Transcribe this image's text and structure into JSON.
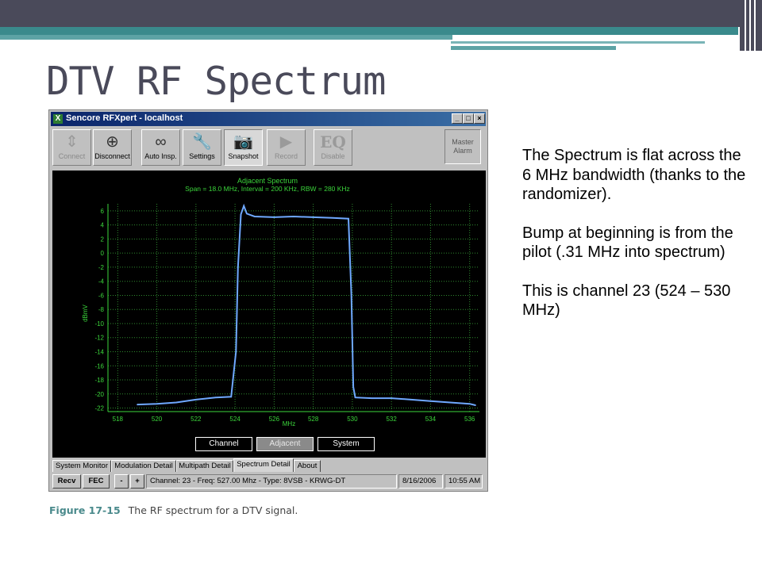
{
  "slide": {
    "title": "DTV RF Spectrum",
    "notes": [
      "The Spectrum is flat across the 6 MHz bandwidth (thanks to the randomizer).",
      "Bump at beginning is from the pilot (.31 MHz into spectrum)",
      "This is channel 23 (524 – 530 MHz)"
    ],
    "caption_label": "Figure 17-15",
    "caption_text": "The RF spectrum for a DTV signal."
  },
  "window": {
    "title": "Sencore RFXpert - localhost",
    "controls": [
      "_",
      "□",
      "×"
    ]
  },
  "toolbar": {
    "buttons": [
      {
        "label": "Connect",
        "icon": "connect-icon",
        "glyph": "⇕",
        "enabled": false
      },
      {
        "label": "Disconnect",
        "icon": "disconnect-icon",
        "glyph": "⊕",
        "enabled": true
      },
      {
        "label": "Auto Insp.",
        "icon": "binoculars-icon",
        "glyph": "∞",
        "enabled": true
      },
      {
        "label": "Settings",
        "icon": "wrench-icon",
        "glyph": "🔧",
        "enabled": true
      },
      {
        "label": "Snapshot",
        "icon": "camera-icon",
        "glyph": "📷",
        "enabled": true,
        "active": true
      },
      {
        "label": "Record",
        "icon": "video-camera-icon",
        "glyph": "▶",
        "enabled": false
      },
      {
        "label": "Disable",
        "icon": "eq-icon",
        "glyph": "EQ",
        "enabled": false
      }
    ],
    "master_alarm": "Master Alarm"
  },
  "chart_data": {
    "type": "line",
    "title": "Adjacent Spectrum",
    "subtitle": "Span = 18.0 MHz, Interval = 200 KHz, RBW = 280 KHz",
    "xlabel": "MHz",
    "ylabel": "dBmV",
    "xlim": [
      517.5,
      536.5
    ],
    "ylim": [
      -22.5,
      7
    ],
    "xticks": [
      518,
      520,
      522,
      524,
      526,
      528,
      530,
      532,
      534,
      536
    ],
    "yticks": [
      6,
      4,
      2,
      0,
      -2,
      -4,
      -6,
      -8,
      -10,
      -12,
      -14,
      -16,
      -18,
      -20,
      -22
    ],
    "grid": true,
    "line_color": "#6fa8ff",
    "series": [
      {
        "x": [
          519,
          520,
          521,
          522,
          523,
          523.8,
          524.05,
          524.15,
          524.3,
          524.45,
          524.6,
          525,
          526,
          527,
          528,
          529,
          529.8,
          529.95,
          530.05,
          530.15,
          531,
          532,
          533,
          534,
          535,
          536,
          536.3
        ],
        "values": [
          -21.5,
          -21.4,
          -21.2,
          -20.8,
          -20.5,
          -20.4,
          -14,
          -2,
          5.5,
          6.7,
          5.6,
          5.2,
          5.1,
          5.2,
          5.1,
          5.0,
          4.9,
          -6,
          -19,
          -20.5,
          -20.6,
          -20.6,
          -20.8,
          -21.0,
          -21.2,
          -21.4,
          -21.6
        ]
      }
    ]
  },
  "view_buttons": [
    {
      "label": "Channel",
      "selected": false
    },
    {
      "label": "Adjacent",
      "selected": true
    },
    {
      "label": "System",
      "selected": false
    }
  ],
  "tabs": [
    "System Monitor",
    "Modulation Detail",
    "Multipath Detail",
    "Spectrum Detail",
    "About"
  ],
  "active_tab": "Spectrum Detail",
  "status": {
    "recv": "Recv",
    "fec": "FEC",
    "minus": "-",
    "plus": "+",
    "channel_info": "Channel: 23 - Freq: 527.00 Mhz - Type: 8VSB - KRWG-DT",
    "date": "8/16/2006",
    "time": "10:55 AM"
  }
}
